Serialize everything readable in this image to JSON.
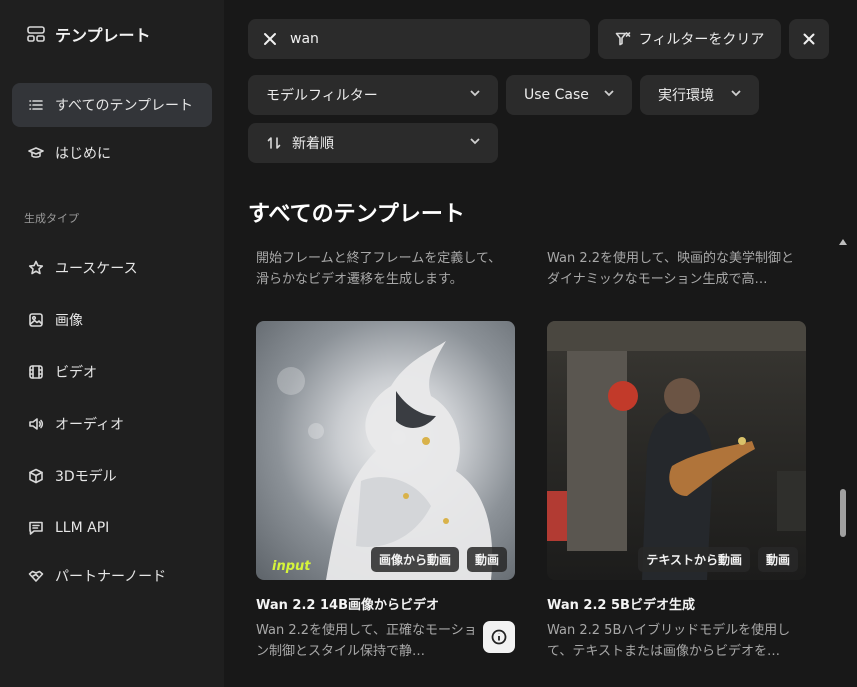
{
  "sidebar": {
    "title": "テンプレート",
    "items": [
      {
        "label": "すべてのテンプレート"
      },
      {
        "label": "はじめに"
      }
    ],
    "section_label": "生成タイプ",
    "types": [
      {
        "label": "ユースケース"
      },
      {
        "label": "画像"
      },
      {
        "label": "ビデオ"
      },
      {
        "label": "オーディオ"
      },
      {
        "label": "3Dモデル"
      },
      {
        "label": "LLM API"
      },
      {
        "label": "パートナーノード"
      }
    ]
  },
  "search": {
    "value": "wan"
  },
  "toolbar": {
    "clear_filter_label": "フィルターをクリア"
  },
  "filters": {
    "model_filter": "モデルフィルター",
    "use_case": "Use Case",
    "runtime": "実行環境",
    "sort": "新着順"
  },
  "main": {
    "section_title": "すべてのテンプレート",
    "partial_cards": [
      {
        "desc": "開始フレームと終了フレームを定義して、滑らかなビデオ遷移を生成します。"
      },
      {
        "desc": "Wan 2.2を使用して、映画的な美学制御とダイナミックなモーション生成で高…"
      }
    ],
    "cards": [
      {
        "title": "Wan 2.2 14B画像からビデオ",
        "desc": "Wan 2.2を使用して、正確なモーション制御とスタイル保持で静…",
        "tags": [
          "画像から動画",
          "動画"
        ],
        "image_stamp": "input"
      },
      {
        "title": "Wan 2.2 5Bビデオ生成",
        "desc": "Wan 2.2 5Bハイブリッドモデルを使用して、テキストまたは画像からビデオを…",
        "tags": [
          "テキストから動画",
          "動画"
        ]
      }
    ]
  }
}
